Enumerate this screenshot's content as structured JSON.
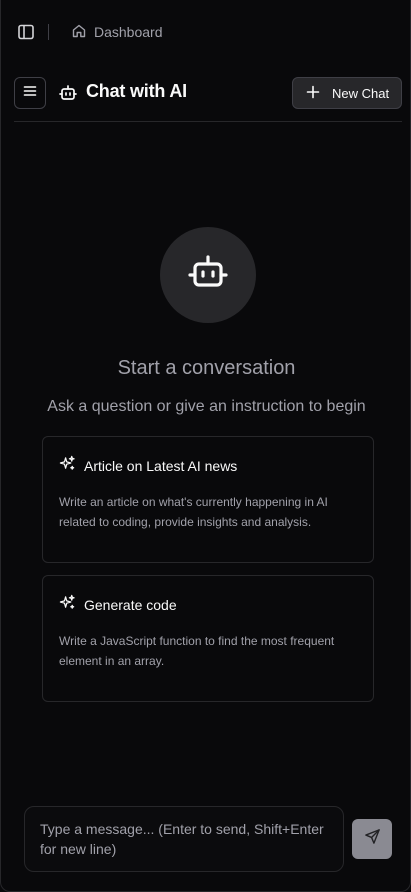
{
  "topbar": {
    "sidebar_toggle_icon": "panel-left-icon",
    "breadcrumb_icon": "home-icon",
    "breadcrumb_label": "Dashboard"
  },
  "chat": {
    "menu_icon": "hamburger-menu-icon",
    "title_icon": "bot-icon",
    "title": "Chat with AI",
    "new_chat_label": "New Chat"
  },
  "empty_state": {
    "title": "Start a conversation",
    "subtitle": "Ask a question or give an instruction to begin"
  },
  "suggestions": [
    {
      "icon": "sparkles-icon",
      "title": "Article on Latest AI news",
      "description": "Write an article on what's currently happening in AI related to coding, provide insights and analysis."
    },
    {
      "icon": "sparkles-icon",
      "title": "Generate code",
      "description": "Write a JavaScript function to find the most frequent element in an array."
    }
  ],
  "composer": {
    "placeholder": "Type a message... (Enter to send, Shift+Enter for new line)",
    "value": "",
    "send_icon": "send-icon"
  },
  "colors": {
    "background": "#09090b",
    "border": "#27272a",
    "muted_text": "#a1a1aa",
    "text": "#fafafa",
    "send_button": "#a1a1aa"
  }
}
